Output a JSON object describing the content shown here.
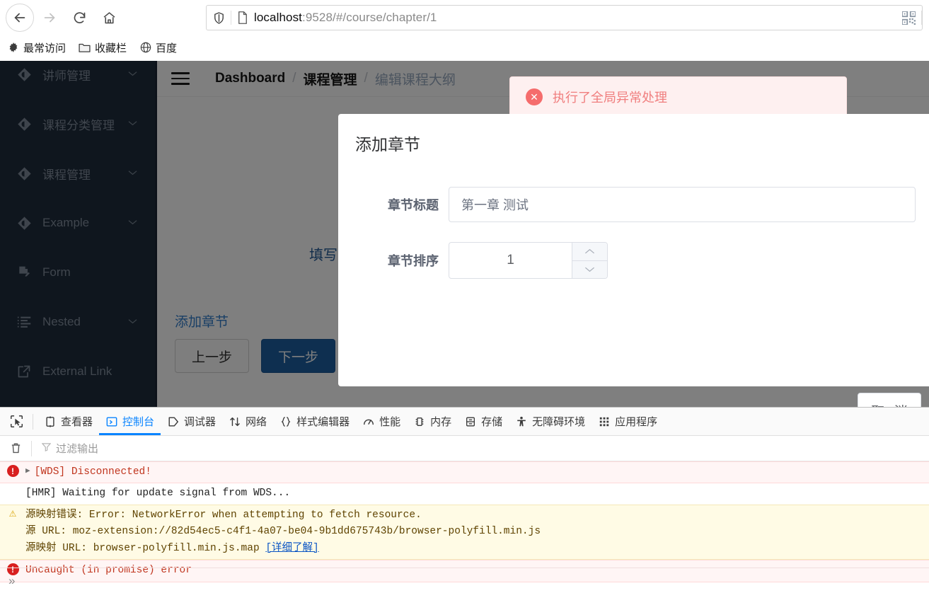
{
  "browser": {
    "back_icon": "arrow-left-icon",
    "forward_icon": "arrow-right-icon",
    "reload_icon": "reload-icon",
    "home_icon": "home-icon",
    "shield_icon": "shield-icon",
    "page_icon": "page-icon",
    "qr_icon": "qr-code-icon",
    "url_host": "localhost",
    "url_rest": ":9528/#/course/chapter/1",
    "bookmarks": [
      {
        "icon": "gear-icon",
        "label": "最常访问"
      },
      {
        "icon": "folder-icon",
        "label": "收藏栏"
      },
      {
        "icon": "globe-icon",
        "label": "百度"
      }
    ]
  },
  "sidebar": {
    "items": [
      {
        "icon": "component-icon",
        "label": "讲师管理",
        "expandable": true
      },
      {
        "icon": "component-icon",
        "label": "课程分类管理",
        "expandable": true
      },
      {
        "icon": "component-icon",
        "label": "课程管理",
        "expandable": true
      },
      {
        "icon": "component-icon",
        "label": "Example",
        "expandable": true
      },
      {
        "icon": "form-icon",
        "label": "Form",
        "expandable": false
      },
      {
        "icon": "nested-icon",
        "label": "Nested",
        "expandable": true
      },
      {
        "icon": "external-link-icon",
        "label": "External Link",
        "expandable": false
      }
    ]
  },
  "navbar": {
    "hamburger_icon": "hamburger-icon",
    "breadcrumb": [
      {
        "label": "Dashboard",
        "muted": false
      },
      {
        "label": "课程管理",
        "muted": false
      },
      {
        "label": "编辑课程大纲",
        "muted": true
      }
    ],
    "separator": "/"
  },
  "content": {
    "steps_hint": "填写",
    "add_chapter_link": "添加章节",
    "prev_button": "上一步",
    "next_button": "下一步"
  },
  "toast": {
    "icon": "error-circle-icon",
    "glyph": "✕",
    "message": "执行了全局异常处理",
    "bg_color": "#fef0f0",
    "text_color": "#f07e7e",
    "accent_color": "#f56c6c"
  },
  "modal": {
    "title": "添加章节",
    "fields": [
      {
        "label": "章节标题",
        "value": "第一章 测试",
        "type": "text"
      },
      {
        "label": "章节排序",
        "value": "1",
        "type": "number"
      }
    ],
    "number_up_icon": "chevron-up-icon",
    "number_down_icon": "chevron-down-icon",
    "cancel_button": "取 消"
  },
  "devtools": {
    "picker_icon": "element-picker-icon",
    "tabs": [
      {
        "icon": "inspector-icon",
        "label": "查看器",
        "active": false
      },
      {
        "icon": "console-icon",
        "label": "控制台",
        "active": true
      },
      {
        "icon": "debugger-icon",
        "label": "调试器",
        "active": false
      },
      {
        "icon": "network-icon",
        "label": "网络",
        "active": false
      },
      {
        "icon": "style-editor-icon",
        "label": "样式编辑器",
        "active": false
      },
      {
        "icon": "performance-icon",
        "label": "性能",
        "active": false
      },
      {
        "icon": "memory-icon",
        "label": "内存",
        "active": false
      },
      {
        "icon": "storage-icon",
        "label": "存储",
        "active": false
      },
      {
        "icon": "accessibility-icon",
        "label": "无障碍环境",
        "active": false
      },
      {
        "icon": "application-icon",
        "label": "应用程序",
        "active": false
      }
    ],
    "active_tab_color": "#0a84ff",
    "trash_icon": "trash-icon",
    "filter_icon": "filter-icon",
    "filter_placeholder": "过滤输出",
    "prompt_glyph": "»",
    "console_logs": [
      {
        "level": "error",
        "expandable": true,
        "lines": [
          "[WDS] Disconnected!"
        ]
      },
      {
        "level": "plain",
        "expandable": false,
        "lines": [
          "[HMR] Waiting for update signal from WDS..."
        ]
      },
      {
        "level": "warn",
        "expandable": false,
        "lines": [
          "源映射错误: Error: NetworkError when attempting to fetch resource.",
          "源 URL: moz-extension://82d54ec5-c4f1-4a07-be04-9b1dd675743b/browser-polyfill.min.js",
          "源映射 URL: browser-polyfill.min.js.map "
        ],
        "link": "[详细了解]"
      },
      {
        "level": "error",
        "expandable": false,
        "lines": [
          "Uncaught (in promise) error"
        ]
      }
    ]
  }
}
